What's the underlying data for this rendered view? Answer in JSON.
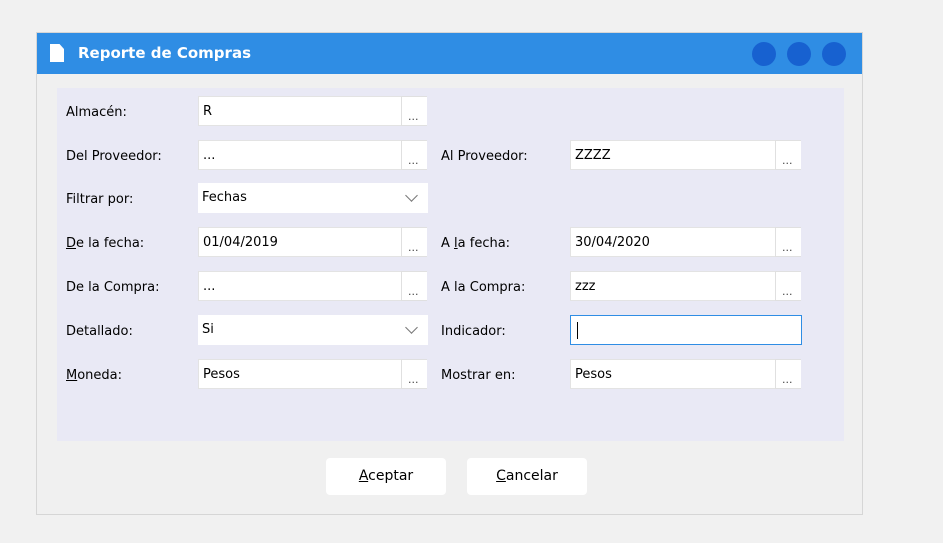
{
  "window": {
    "title": "Reporte de Compras",
    "accent": "#2f8de4",
    "control_buttons": [
      "minimize-dot",
      "maximize-dot",
      "close-dot"
    ]
  },
  "form": {
    "almacen": {
      "label": "Almacén:",
      "value": "R",
      "browse": "..."
    },
    "del_proveedor": {
      "label": "Del Proveedor:",
      "value": "...",
      "browse": "..."
    },
    "al_proveedor": {
      "label": "Al Proveedor:",
      "value": "ZZZZ",
      "browse": "..."
    },
    "filtrar_por": {
      "label": "Filtrar por:",
      "value": "Fechas"
    },
    "de_la_fecha": {
      "label_access": "D",
      "label_rest": "e la fecha:",
      "value": "01/04/2019",
      "browse": "..."
    },
    "a_la_fecha": {
      "label_pre": "A ",
      "label_access": "l",
      "label_rest": "a fecha:",
      "value": "30/04/2020",
      "browse": "..."
    },
    "de_la_compra": {
      "label": "De la Compra:",
      "value": "...",
      "browse": "..."
    },
    "a_la_compra": {
      "label": "A la Compra:",
      "value": "zzz",
      "browse": "..."
    },
    "detallado": {
      "label": "Detallado:",
      "value": "Si"
    },
    "indicador": {
      "label": "Indicador:",
      "value": ""
    },
    "moneda": {
      "label_access": "M",
      "label_rest": "oneda:",
      "value": "Pesos",
      "browse": "..."
    },
    "mostrar_en": {
      "label": "Mostrar en:",
      "value": "Pesos",
      "browse": "..."
    }
  },
  "buttons": {
    "aceptar": {
      "access": "A",
      "rest": "ceptar"
    },
    "cancelar": {
      "access": "C",
      "rest": "ancelar"
    }
  }
}
